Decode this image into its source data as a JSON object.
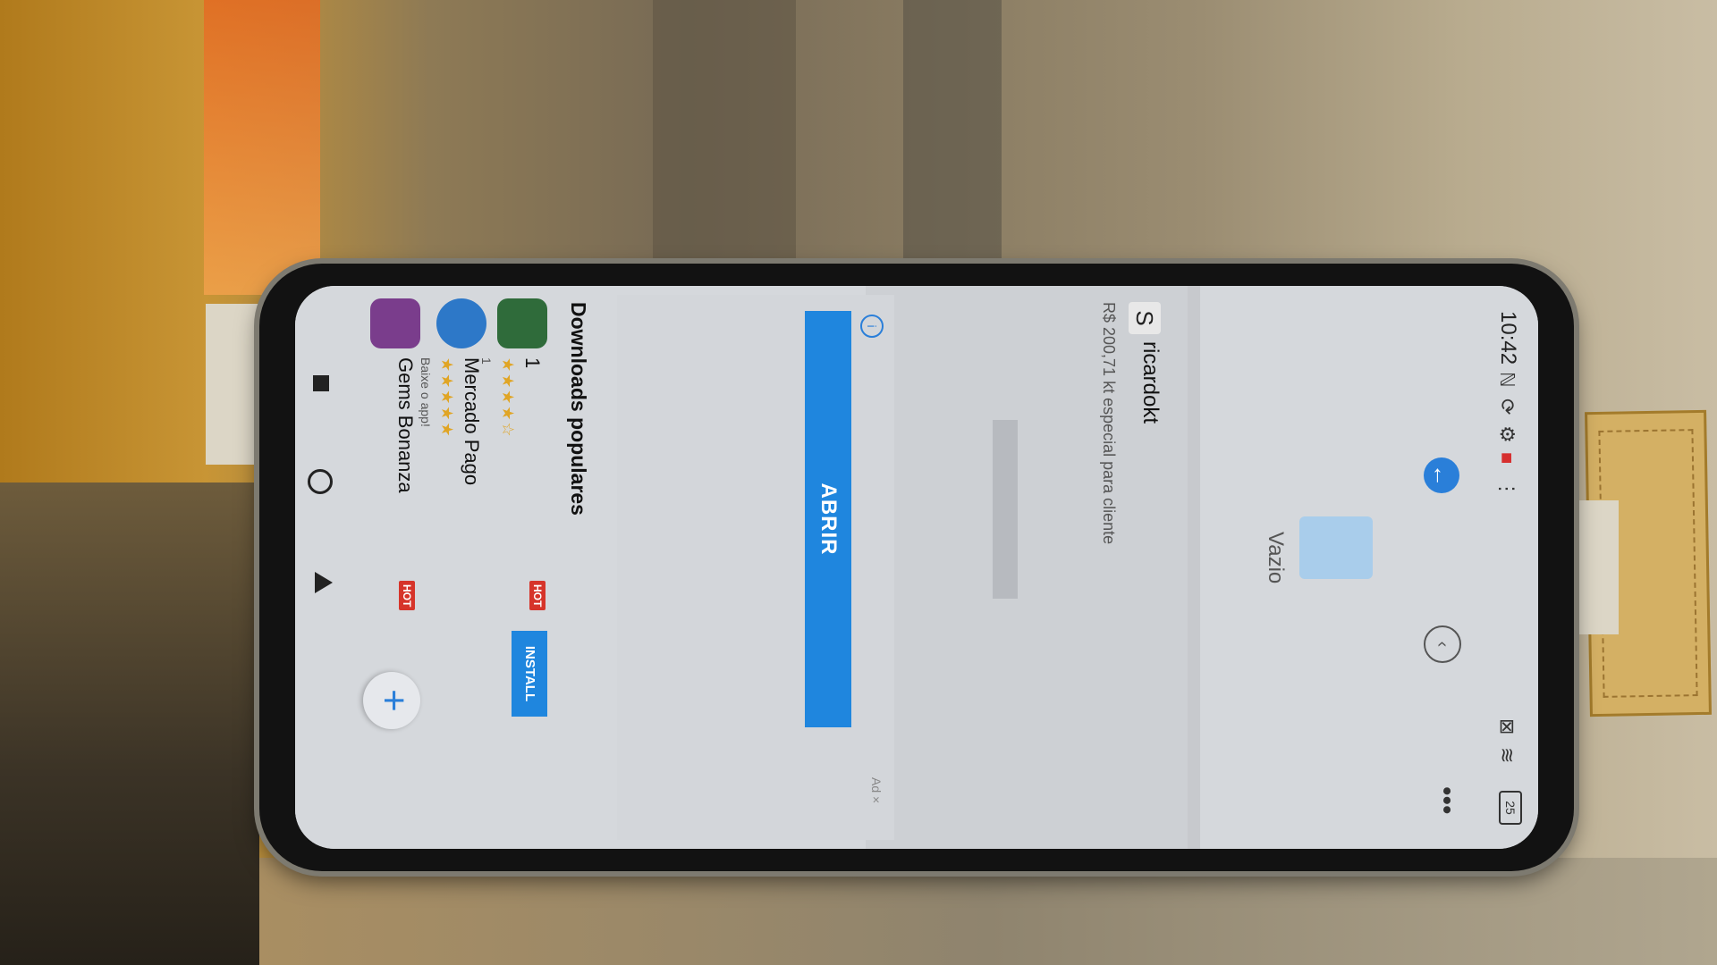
{
  "status_bar": {
    "time": "10:42",
    "battery": "25",
    "icons": [
      "nfc-icon",
      "sync-icon",
      "gear-icon",
      "notification-icon",
      "more-dots-icon",
      "close-box-icon",
      "wifi-icon"
    ]
  },
  "top_bar": {
    "back_icon": "←",
    "more_icon": "•••",
    "circle_icon": "‹"
  },
  "empty_state": {
    "label": "Vazio"
  },
  "card": {
    "avatar_letter": "S",
    "name": "ricardokt",
    "price_text": "R$ 200,71 kt especial para cliente"
  },
  "ad": {
    "open_button": "ABRIR",
    "tag": "Ad ×"
  },
  "downloads": {
    "title": "Downloads populares",
    "apps": [
      {
        "name": "1",
        "stars": "★★★★☆",
        "sub": "1",
        "hot": "HOT",
        "install": "INSTALL",
        "icon_color": "#2f6b3a"
      },
      {
        "name": "Mercado Pago",
        "stars": "★★★★★",
        "sub": "Baixe o app!",
        "hot": "",
        "install": "",
        "icon_color": "#2d78c8"
      },
      {
        "name": "Gems Bonanza",
        "stars": "",
        "sub": "",
        "hot": "HOT",
        "install": "",
        "icon_color": "#7a3d8c"
      }
    ]
  },
  "fab": {
    "label": "+"
  },
  "colors": {
    "accent": "#1f86de",
    "hot": "#d6342a"
  }
}
